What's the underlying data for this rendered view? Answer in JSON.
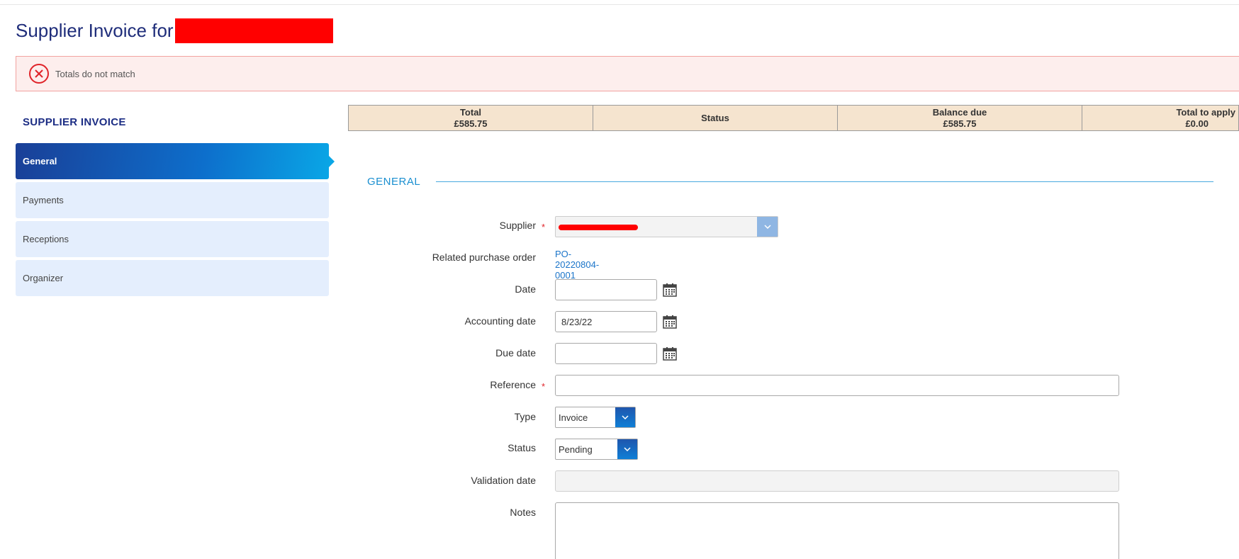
{
  "page": {
    "title": "Supplier Invoice for"
  },
  "alert": {
    "message": "Totals do not match"
  },
  "sidebar": {
    "heading": "SUPPLIER INVOICE",
    "items": [
      {
        "label": "General"
      },
      {
        "label": "Payments"
      },
      {
        "label": "Receptions"
      },
      {
        "label": "Organizer"
      }
    ]
  },
  "summary": {
    "total_label": "Total",
    "total_value": "£585.75",
    "status_label": "Status",
    "balance_label": "Balance due",
    "balance_value": "£585.75",
    "apply_label": "Total to apply",
    "apply_value": "£0.00"
  },
  "section": {
    "title": "GENERAL"
  },
  "form": {
    "supplier_label": "Supplier",
    "related_po_label": "Related purchase order",
    "related_po_value": "PO-20220804-0001",
    "date_label": "Date",
    "date_value": "",
    "accounting_date_label": "Accounting date",
    "accounting_date_value": "8/23/22",
    "due_date_label": "Due date",
    "due_date_value": "",
    "reference_label": "Reference",
    "reference_value": "",
    "type_label": "Type",
    "type_value": "Invoice",
    "status_label": "Status",
    "status_value": "Pending",
    "validation_date_label": "Validation date",
    "validation_date_value": "",
    "notes_label": "Notes",
    "notes_value": ""
  },
  "colors": {
    "title": "#1f2d7a",
    "alert_bg": "#fdeeed",
    "alert_icon": "#e0242a",
    "sidebar_active": "#0d6fcc",
    "sidebar_item_bg": "#e4eefd",
    "summary_bg": "#f5e4cf",
    "section_accent": "#1a8fd0",
    "link": "#1a74c9",
    "required": "#e0242a"
  },
  "icons": {
    "alert": "close-circle-icon",
    "dropdown": "chevron-down-icon",
    "date_picker": "calendar-icon"
  }
}
